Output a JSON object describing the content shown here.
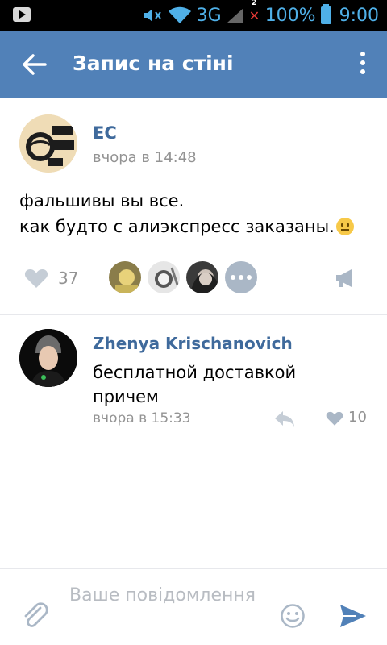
{
  "status_bar": {
    "network": "3G",
    "sim_badge": "2",
    "battery": "100%",
    "time": "9:00"
  },
  "toolbar": {
    "title": "Запис на стіні"
  },
  "post": {
    "author": "ЕС",
    "time": "вчора в 14:48",
    "text_line1": "фальшивы вы все.",
    "text_line2": "как будто с алиэкспресс заказаны.",
    "emoji": "neutral-face",
    "likes_count": "37"
  },
  "comment": {
    "author": "Zhenya Krischanovich",
    "text": "бесплатной доставкой причем",
    "time": "вчора в 15:33",
    "likes_count": "10"
  },
  "composer": {
    "placeholder": "Ваше повідомлення"
  },
  "colors": {
    "toolbar_bg": "#5181b8",
    "link_blue": "#3f6a9c",
    "meta_grey": "#939393",
    "icon_grey": "#aab7c6",
    "send_blue": "#5181b8"
  }
}
